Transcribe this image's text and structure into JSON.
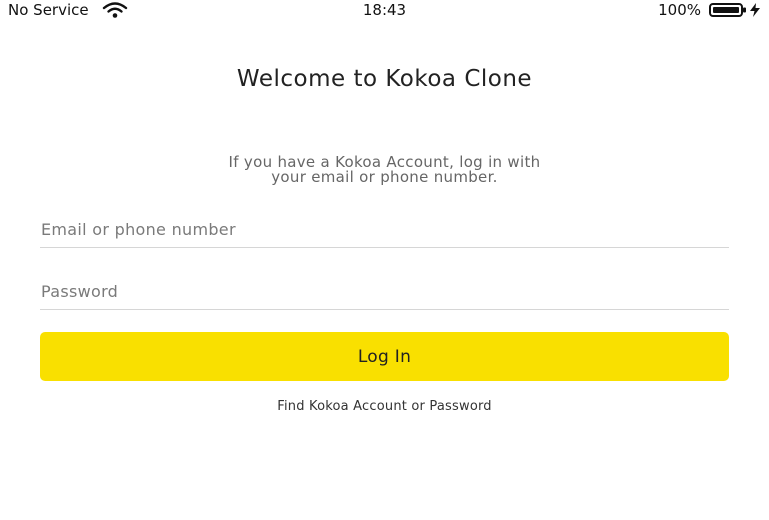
{
  "status_bar": {
    "carrier": "No Service",
    "time": "18:43",
    "battery_percent": "100%",
    "icons": [
      "wifi-icon",
      "battery-icon",
      "bolt-icon"
    ]
  },
  "login": {
    "title": "Welcome to Kokoa Clone",
    "subtitle_line1": "If you have a Kokoa Account, log in with",
    "subtitle_line2": "your email or phone number.",
    "email_placeholder": "Email or phone number",
    "password_placeholder": "Password",
    "login_button": "Log In",
    "find_account_link": "Find Kokoa Account or Password"
  },
  "colors": {
    "button_yellow": "#f9e000",
    "text_dark": "#222222",
    "placeholder_gray": "#7a7a7a",
    "divider_gray": "#d6d6d6"
  }
}
